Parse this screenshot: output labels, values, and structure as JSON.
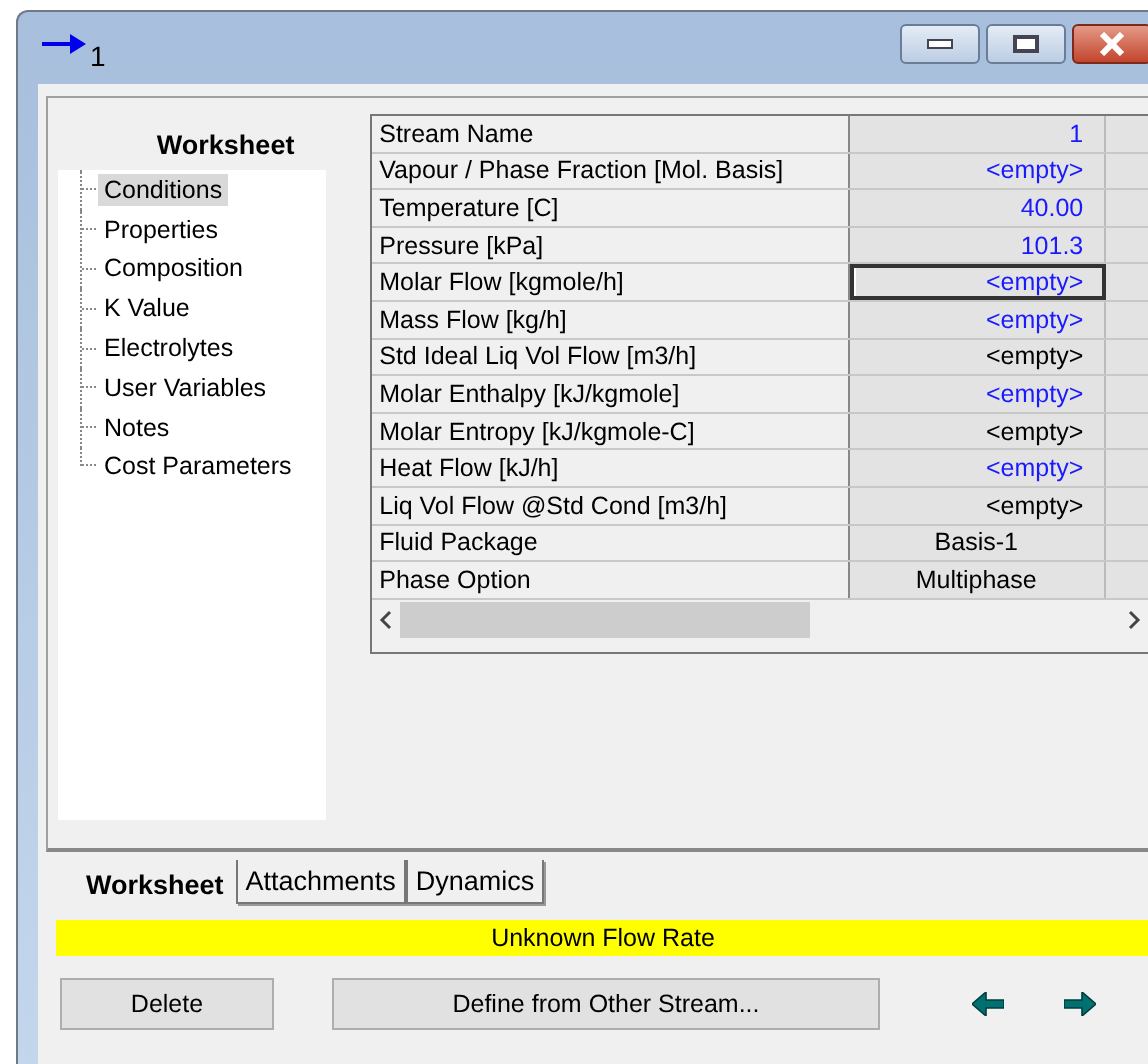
{
  "window": {
    "title": "1"
  },
  "sidebar": {
    "title": "Worksheet",
    "items": [
      {
        "label": "Conditions",
        "selected": true
      },
      {
        "label": "Properties",
        "selected": false
      },
      {
        "label": "Composition",
        "selected": false
      },
      {
        "label": "K Value",
        "selected": false
      },
      {
        "label": "Electrolytes",
        "selected": false
      },
      {
        "label": "User Variables",
        "selected": false
      },
      {
        "label": "Notes",
        "selected": false
      },
      {
        "label": "Cost Parameters",
        "selected": false
      }
    ]
  },
  "table": {
    "rows": [
      {
        "label": "Stream Name",
        "value": "1",
        "kind": "number",
        "specified": true,
        "focused": false
      },
      {
        "label": "Vapour / Phase Fraction [Mol. Basis]",
        "value": "<empty>",
        "kind": "number",
        "specified": true,
        "focused": false
      },
      {
        "label": "Temperature [C]",
        "value": "40.00",
        "kind": "number",
        "specified": true,
        "focused": false
      },
      {
        "label": "Pressure [kPa]",
        "value": "101.3",
        "kind": "number",
        "specified": true,
        "focused": false
      },
      {
        "label": "Molar Flow [kgmole/h]",
        "value": "<empty>",
        "kind": "number",
        "specified": true,
        "focused": true
      },
      {
        "label": "Mass Flow [kg/h]",
        "value": "<empty>",
        "kind": "number",
        "specified": true,
        "focused": false
      },
      {
        "label": "Std Ideal Liq Vol Flow [m3/h]",
        "value": "<empty>",
        "kind": "number",
        "specified": false,
        "focused": false
      },
      {
        "label": "Molar Enthalpy [kJ/kgmole]",
        "value": "<empty>",
        "kind": "number",
        "specified": true,
        "focused": false
      },
      {
        "label": "Molar Entropy [kJ/kgmole-C]",
        "value": "<empty>",
        "kind": "number",
        "specified": false,
        "focused": false
      },
      {
        "label": "Heat Flow [kJ/h]",
        "value": "<empty>",
        "kind": "number",
        "specified": true,
        "focused": false
      },
      {
        "label": "Liq Vol Flow @Std Cond [m3/h]",
        "value": "<empty>",
        "kind": "number",
        "specified": false,
        "focused": false
      },
      {
        "label": "Fluid Package",
        "value": "Basis-1",
        "kind": "choice",
        "specified": false,
        "focused": false
      },
      {
        "label": "Phase Option",
        "value": "Multiphase",
        "kind": "choice",
        "specified": false,
        "focused": false
      }
    ]
  },
  "tabs": [
    {
      "label": "Worksheet",
      "selected": true
    },
    {
      "label": "Attachments",
      "selected": false
    },
    {
      "label": "Dynamics",
      "selected": false
    }
  ],
  "status_bar": "Unknown Flow Rate",
  "buttons": [
    "Delete",
    "Define from Other Stream..."
  ]
}
